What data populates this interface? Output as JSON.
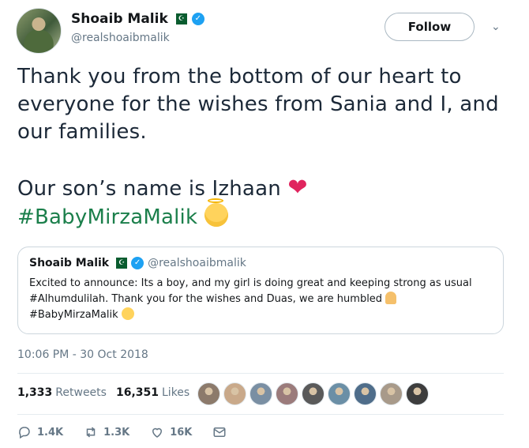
{
  "author": {
    "display_name": "Shoaib Malik",
    "handle": "@realshoaibmalik",
    "verified_icon": "check-icon"
  },
  "follow_label": "Follow",
  "tweet": {
    "line1": "Thank you from the bottom of our heart to",
    "line2": "everyone for the wishes from Sania and I, and",
    "line3": "our families.",
    "line4": "Our son’s name is Izhaan",
    "heart": "❤",
    "hashtag": "#BabyMirzaMalik"
  },
  "quoted": {
    "display_name": "Shoaib Malik",
    "handle": "@realshoaibmalik",
    "line1": "Excited to announce: Its a boy, and my girl is doing great and keeping strong as usual",
    "line2": "#Alhumdulilah. Thank you for the wishes and Duas, we are humbled",
    "line3": "#BabyMirzaMalik"
  },
  "timestamp": "10:06 PM - 30 Oct 2018",
  "stats": {
    "retweets_count": "1,333",
    "retweets_label": "Retweets",
    "likes_count": "16,351",
    "likes_label": "Likes"
  },
  "liker_avatar_colors": [
    "#8c7a6b",
    "#c9a98a",
    "#7a8fa3",
    "#9b7b7b",
    "#5a5a5a",
    "#6b8fa6",
    "#4f6d8a",
    "#a89a8a",
    "#3d3d3d"
  ],
  "actions": {
    "reply_count": "1.4K",
    "retweet_count": "1.3K",
    "like_count": "16K"
  },
  "colors": {
    "hashtag": "#1b7f4b",
    "heart": "#e0245e",
    "secondary_text": "#657786"
  }
}
